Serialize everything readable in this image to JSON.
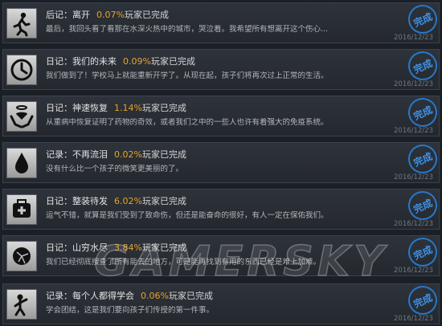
{
  "watermark": "GAMERSKY",
  "accent_color": "#e6a22a",
  "stamp_color": "#2778c9",
  "achievements": [
    {
      "icon": "runner-icon",
      "title": "后记：离开",
      "percent": "0.07%",
      "players": "玩家已完成",
      "description": "最后，我回头看了看那在水深火热中的城市，哭泣着。我希望所有想离开这个伤心...",
      "stamp": "完成",
      "date": "2016/12/23"
    },
    {
      "icon": "clock-icon",
      "title": "日记：我们的未来",
      "percent": "0.09%",
      "players": "玩家已完成",
      "description": "我们做到了！学校马上就能重新开学了。从现在起，孩子们将再次过上正常的生活。",
      "stamp": "完成",
      "date": "2016/12/23"
    },
    {
      "icon": "healing-hands-icon",
      "title": "日记：神速恢复",
      "percent": "1.14%",
      "players": "玩家已完成",
      "description": "从重病中恢复证明了药物的奇效，或者我们之中的一些人也许有着强大的免疫系统。",
      "stamp": "完成",
      "date": "2016/12/23"
    },
    {
      "icon": "teardrop-icon",
      "title": "记录：不再流泪",
      "percent": "0.02%",
      "players": "玩家已完成",
      "description": "没有什么比一个孩子的微笑更美丽的了。",
      "stamp": "完成",
      "date": "2016/12/23"
    },
    {
      "icon": "medkit-icon",
      "title": "日记：整装待发",
      "percent": "6.02%",
      "players": "玩家已完成",
      "description": "运气不错，就算是我们受到了致命伤，但还是能奋命的很好，有人一定在保佑我们。",
      "stamp": "完成",
      "date": "2016/12/23"
    },
    {
      "icon": "broken-globe-icon",
      "title": "日记：山穷水尽",
      "percent": "3.84%",
      "players": "玩家已完成",
      "description": "我们已经彻底搜查了所有能去的地方，可是能再找到有用的东西已经是难上加难。",
      "stamp": "完成",
      "date": "2016/12/23"
    },
    {
      "icon": "child-icon",
      "title": "记录：每个人都得学会",
      "percent": "0.06%",
      "players": "玩家已完成",
      "description": "学会团结，这是我们要向孩子们传授的第一件事。",
      "stamp": "完成",
      "date": "2016/12/23"
    }
  ]
}
